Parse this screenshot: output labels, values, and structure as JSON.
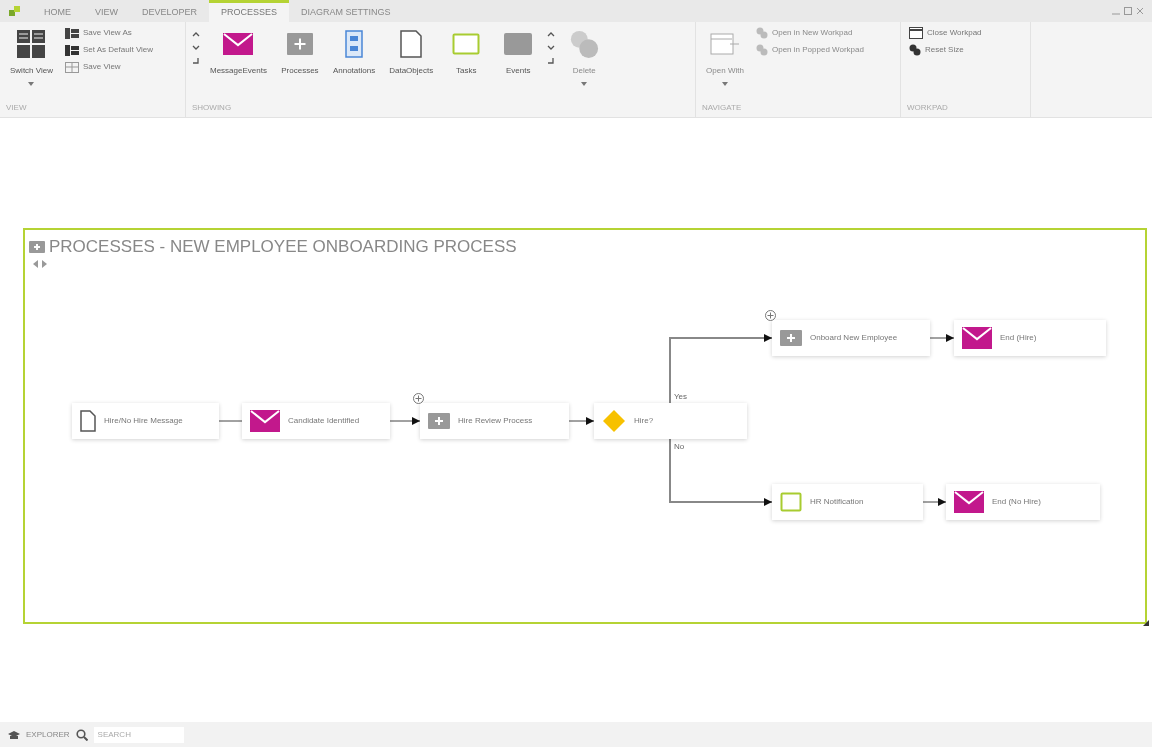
{
  "ribbon_tabs": [
    {
      "label": "HOME",
      "selected": false
    },
    {
      "label": "VIEW",
      "selected": false
    },
    {
      "label": "DEVELOPER",
      "selected": false
    },
    {
      "label": "PROCESSES",
      "selected": true
    },
    {
      "label": "DIAGRAM SETTINGS",
      "selected": false
    }
  ],
  "ribbon_groups": [
    {
      "label": "VIEW",
      "items": [
        {
          "kind": "large",
          "label": "Switch View",
          "dropdown": true,
          "disabled": false
        },
        {
          "kind": "small",
          "label": "Save View As",
          "disabled": false
        },
        {
          "kind": "small",
          "label": "Set As Default View",
          "disabled": false
        },
        {
          "kind": "small",
          "label": "Save View",
          "disabled": false
        }
      ]
    },
    {
      "label": "SHOWING",
      "items": [
        {
          "kind": "scroller"
        },
        {
          "kind": "large",
          "label": "MessageEvents",
          "dropdown": false,
          "disabled": false
        },
        {
          "kind": "large",
          "label": "Processes",
          "dropdown": false,
          "disabled": false
        },
        {
          "kind": "large",
          "label": "Annotations",
          "dropdown": false,
          "disabled": false
        },
        {
          "kind": "large",
          "label": "DataObjects",
          "dropdown": false,
          "disabled": false
        },
        {
          "kind": "large",
          "label": "Tasks",
          "dropdown": false,
          "disabled": false
        },
        {
          "kind": "large",
          "label": "Events",
          "dropdown": false,
          "disabled": false
        },
        {
          "kind": "scroller"
        },
        {
          "kind": "large",
          "label": "Delete",
          "dropdown": true,
          "disabled": true
        }
      ]
    },
    {
      "label": "NAVIGATE",
      "items": [
        {
          "kind": "large",
          "label": "Open With",
          "dropdown": true,
          "disabled": true
        },
        {
          "kind": "small",
          "label": "Open in New Workpad",
          "disabled": true
        },
        {
          "kind": "small",
          "label": "Open in Popped Workpad",
          "disabled": true
        }
      ]
    },
    {
      "label": "WORKPAD",
      "items": [
        {
          "kind": "small",
          "label": "Close Workpad",
          "disabled": false
        },
        {
          "kind": "small",
          "label": "Reset Size",
          "disabled": false
        }
      ]
    }
  ],
  "diagram": {
    "title": "PROCESSES - NEW EMPLOYEE ONBOARDING PROCESS",
    "nodes": [
      {
        "kind": "document",
        "label": "Hire/No Hire Message",
        "expandable": false
      },
      {
        "kind": "message",
        "label": "Candidate Identified",
        "expandable": false
      },
      {
        "kind": "process",
        "label": "Hire Review Process",
        "expandable": true
      },
      {
        "kind": "gateway",
        "label": "Hire?",
        "expandable": false
      },
      {
        "kind": "process",
        "label": "Onboard New Employee",
        "expandable": true
      },
      {
        "kind": "message",
        "label": "End (Hire)",
        "expandable": false
      },
      {
        "kind": "task",
        "label": "HR Notification",
        "expandable": false
      },
      {
        "kind": "message",
        "label": "End (No Hire)",
        "expandable": false
      }
    ],
    "branch_labels": [
      "Yes",
      "No"
    ]
  },
  "status_bar": {
    "explorer": "EXPLORER",
    "search": {
      "placeholder": "SEARCH"
    }
  }
}
